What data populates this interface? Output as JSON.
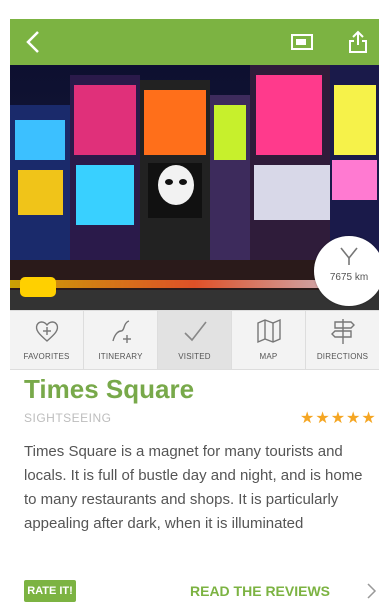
{
  "header": {
    "back_icon": "chevron-left-icon",
    "cast_icon": "cast-icon",
    "share_icon": "share-icon"
  },
  "hero": {
    "distance": "7675 km",
    "distance_icon": "compass-icon"
  },
  "actions": [
    {
      "label": "FAVORITES",
      "icon": "heart-plus-icon"
    },
    {
      "label": "ITINERARY",
      "icon": "route-plus-icon"
    },
    {
      "label": "VISITED",
      "icon": "checkmark-icon"
    },
    {
      "label": "MAP",
      "icon": "map-icon"
    },
    {
      "label": "DIRECTIONS",
      "icon": "signpost-icon"
    }
  ],
  "place": {
    "title": "Times Square",
    "category": "SIGHTSEEING",
    "rating": 4.5,
    "stars": "★★★★★",
    "description": "Times Square is a magnet for many tourists and locals. It is full of bustle day and night, and is home to many restaurants and shops. It is particularly appealing after dark, when it is illuminated"
  },
  "footer": {
    "rate_label": "RATE IT!",
    "reviews_label": "READ THE REVIEWS"
  },
  "colors": {
    "accent": "#7cb342",
    "title": "#78a94a",
    "star": "#f5a623"
  }
}
